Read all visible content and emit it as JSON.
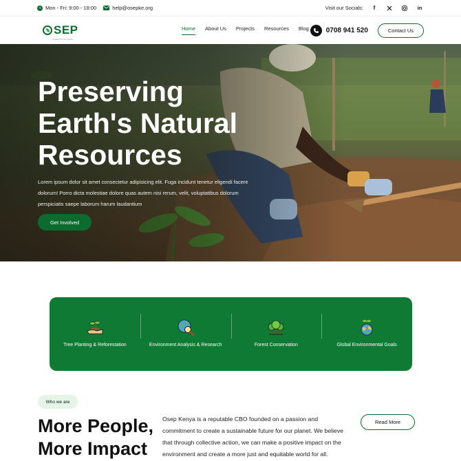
{
  "topbar": {
    "hours": "Mon - Fri: 9:00 - 18:00",
    "email": "help@osepke.org",
    "socials_label": "Visit our Socials:",
    "socials": [
      "facebook-icon",
      "x-icon",
      "instagram-icon",
      "linkedin-icon"
    ]
  },
  "nav": {
    "logo_text": "SEP",
    "logo_sub": "Together for our planet",
    "menu": [
      "Home",
      "About Us",
      "Projects",
      "Resources",
      "Blog"
    ],
    "active": "Home",
    "phone": "0708 941 520",
    "contact_label": "Contact Us"
  },
  "hero": {
    "title_line1": "Preserving",
    "title_line2": "Earth's Natural",
    "title_line3": "Resources",
    "text": "Lorem ipsum dolor sit amet consectetur adipisicing elit. Fuga incidunt tenetur eligendi facere dolorum! Porro dicta molestiae dolore quas autem nisi rerum, velit, voluptatibus dolorum perspiciatis saepe laborum harum laudantium",
    "cta": "Get Involved"
  },
  "features": [
    {
      "label": "Tree Planting & Reforestation",
      "icon": "sprout-hand-icon"
    },
    {
      "label": "Environment Analysis & Research",
      "icon": "globe-magnifier-icon"
    },
    {
      "label": "Forest Conservation",
      "icon": "trees-icon"
    },
    {
      "label": "Global Environmental Goals",
      "icon": "globe-plant-icon"
    }
  ],
  "about": {
    "pill": "Who we are",
    "heading_line1": "More People,",
    "heading_line2": "More Impact",
    "text": "Osep Kenya is a reputable CBO founded on a passion and commitment to create a sustainable future for our planet. We believe that through collective action, we can make a positive impact on the environment and create a more just and equitable world for all.",
    "read_more": "Read More"
  },
  "colors": {
    "brand_green": "#0e6b2f",
    "feature_green": "#0e7a34",
    "pill_bg": "#e4f5e6"
  }
}
